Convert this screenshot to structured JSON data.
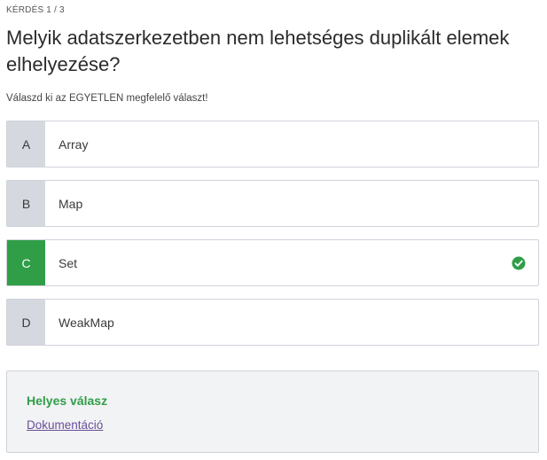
{
  "quiz": {
    "counter": "KÉRDÉS 1 / 3",
    "question": "Melyik adatszerkezetben nem lehetséges duplikált elemek elhelyezése?",
    "instruction": "Válaszd ki az EGYETLEN megfelelő választ!",
    "options": [
      {
        "letter": "A",
        "text": "Array"
      },
      {
        "letter": "B",
        "text": "Map"
      },
      {
        "letter": "C",
        "text": "Set",
        "correct": true
      },
      {
        "letter": "D",
        "text": "WeakMap"
      }
    ],
    "feedback": {
      "status": "Helyes válasz",
      "link_label": "Dokumentáció"
    }
  },
  "colors": {
    "correct": "#2f9e47",
    "letter_bg": "#d5d8df",
    "feedback_bg": "#f2f3f5",
    "link": "#6a4e9a"
  },
  "icons": {
    "correct_check": "check-circle-icon"
  }
}
